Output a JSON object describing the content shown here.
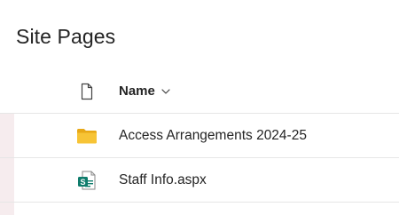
{
  "page": {
    "title": "Site Pages"
  },
  "list": {
    "header": {
      "name_label": "Name",
      "file_type_icon": "document-icon",
      "sort_icon": "chevron-down-icon"
    },
    "items": [
      {
        "name": "Access Arrangements 2024-25",
        "icon": "folder-icon"
      },
      {
        "name": "Staff Info.aspx",
        "icon": "sharepoint-page-icon"
      }
    ]
  },
  "colors": {
    "folder": "#F7C436",
    "sharepoint_green": "#0F7C6C",
    "divider": "#E6E6E6",
    "accent_strip": "#F6ECEE"
  }
}
